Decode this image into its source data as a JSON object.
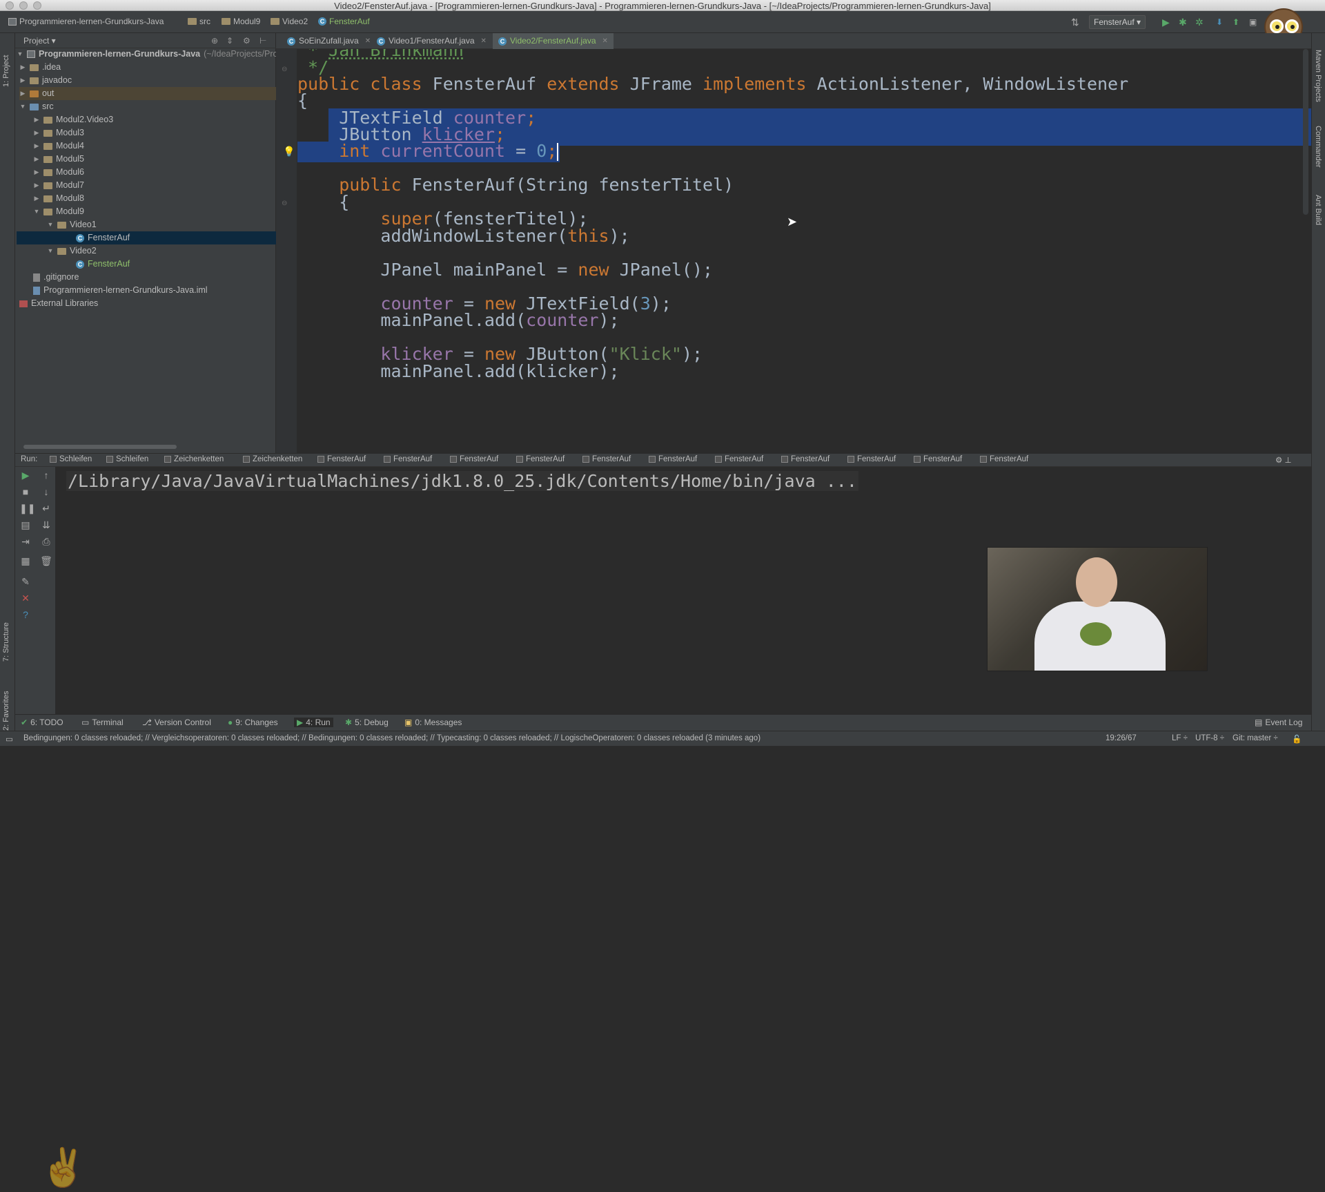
{
  "window": {
    "title": "Video2/FensterAuf.java - [Programmieren-lernen-Grundkurs-Java] - Programmieren-lernen-Grundkurs-Java - [~/IdeaProjects/Programmieren-lernen-Grundkurs-Java]"
  },
  "navbar": {
    "crumbs": [
      "Programmieren-lernen-Grundkurs-Java",
      "src",
      "Modul9",
      "Video2",
      "FensterAuf"
    ],
    "run_config": "FensterAuf ▾"
  },
  "project_panel": {
    "header": "Project ▾",
    "root": "Programmieren-lernen-Grundkurs-Java",
    "root_path": "(~/IdeaProjects/Programmieren-lernen-Grundkurs-Java)",
    "items": [
      {
        "label": ".idea"
      },
      {
        "label": "javadoc"
      },
      {
        "label": "out"
      },
      {
        "label": "src"
      },
      {
        "label": "Modul2.Video3"
      },
      {
        "label": "Modul3"
      },
      {
        "label": "Modul4"
      },
      {
        "label": "Modul5"
      },
      {
        "label": "Modul6"
      },
      {
        "label": "Modul7"
      },
      {
        "label": "Modul8"
      },
      {
        "label": "Modul9"
      },
      {
        "label": "Video1"
      },
      {
        "label": "FensterAuf"
      },
      {
        "label": "Video2"
      },
      {
        "label": "FensterAuf"
      },
      {
        "label": ".gitignore"
      },
      {
        "label": "Programmieren-lernen-Grundkurs-Java.iml"
      },
      {
        "label": "External Libraries"
      }
    ]
  },
  "editor_tabs": [
    {
      "label": "SoEinZufall.java"
    },
    {
      "label": "Video1/FensterAuf.java"
    },
    {
      "label": "Video2/FensterAuf.java"
    }
  ],
  "code": {
    "l1a": " * ",
    "l1b": "Jan Brinkmann",
    "l2": " */",
    "l3a": "public class ",
    "l3b": "FensterAuf ",
    "l3c": "extends ",
    "l3d": "JFrame ",
    "l3e": "implements ",
    "l3f": "ActionListener, WindowListener",
    "l4": "{",
    "l5a": "    JTextField ",
    "l5b": "counter",
    "l5c": ";",
    "l6a": "    JButton ",
    "l6b": "klicker",
    "l6c": ";",
    "l7a": "    int ",
    "l7b": "currentCount",
    "l7c": " = ",
    "l7d": "0",
    "l7e": ";",
    "l9a": "    public ",
    "l9b": "FensterAuf(String fensterTitel)",
    "l10": "    {",
    "l11a": "        super",
    "l11b": "(fensterTitel);",
    "l12a": "        addWindowListener(",
    "l12b": "this",
    "l12c": ");",
    "l14a": "        JPanel mainPanel = ",
    "l14b": "new ",
    "l14c": "JPanel();",
    "l16a": "        counter",
    "l16b": " = ",
    "l16c": "new ",
    "l16d": "JTextField(",
    "l16e": "3",
    "l16f": ");",
    "l17a": "        mainPanel.add(",
    "l17b": "counter",
    "l17c": ");",
    "l19a": "        klicker",
    "l19b": " = ",
    "l19c": "new ",
    "l19d": "JButton(",
    "l19e": "\"Klick\"",
    "l19f": ");",
    "l20": "        mainPanel.add(klicker);"
  },
  "run_tabs": {
    "label": "Run:",
    "tabs": [
      "Schleifen",
      "Schleifen",
      "Zeichenketten",
      "Zeichenketten",
      "FensterAuf",
      "FensterAuf",
      "FensterAuf",
      "FensterAuf",
      "FensterAuf",
      "FensterAuf",
      "FensterAuf",
      "FensterAuf",
      "FensterAuf",
      "FensterAuf",
      "FensterAuf"
    ]
  },
  "console": {
    "line1": "/Library/Java/JavaVirtualMachines/jdk1.8.0_25.jdk/Contents/Home/bin/java ..."
  },
  "left_strip": {
    "project": "1: Project",
    "structure": "7: Structure",
    "favorites": "2: Favorites"
  },
  "right_strip": {
    "maven": "Maven Projects",
    "commander": "Commander",
    "ant": "Ant Build"
  },
  "bottom_tools": [
    {
      "label": "6: TODO"
    },
    {
      "label": "Terminal"
    },
    {
      "label": "Version Control"
    },
    {
      "label": "9: Changes"
    },
    {
      "label": "4: Run"
    },
    {
      "label": "5: Debug"
    },
    {
      "label": "0: Messages"
    }
  ],
  "event_log": "Event Log",
  "status": {
    "message": "Bedingungen: 0 classes reloaded; // Vergleichsoperatoren: 0 classes reloaded; // Bedingungen: 0 classes reloaded; // Typecasting: 0 classes reloaded; // LogischeOperatoren: 0 classes reloaded (3 minutes ago)",
    "position": "19:26/67",
    "line_sep": "LF ÷",
    "encoding": "UTF-8 ÷",
    "vcs": "Git: master ÷"
  },
  "colors": {
    "selection": "#214283",
    "keyword": "#cc7832",
    "field": "#9876aa",
    "number": "#6897bb",
    "string": "#6a8759",
    "active_tab_text": "#8fbf6b"
  }
}
